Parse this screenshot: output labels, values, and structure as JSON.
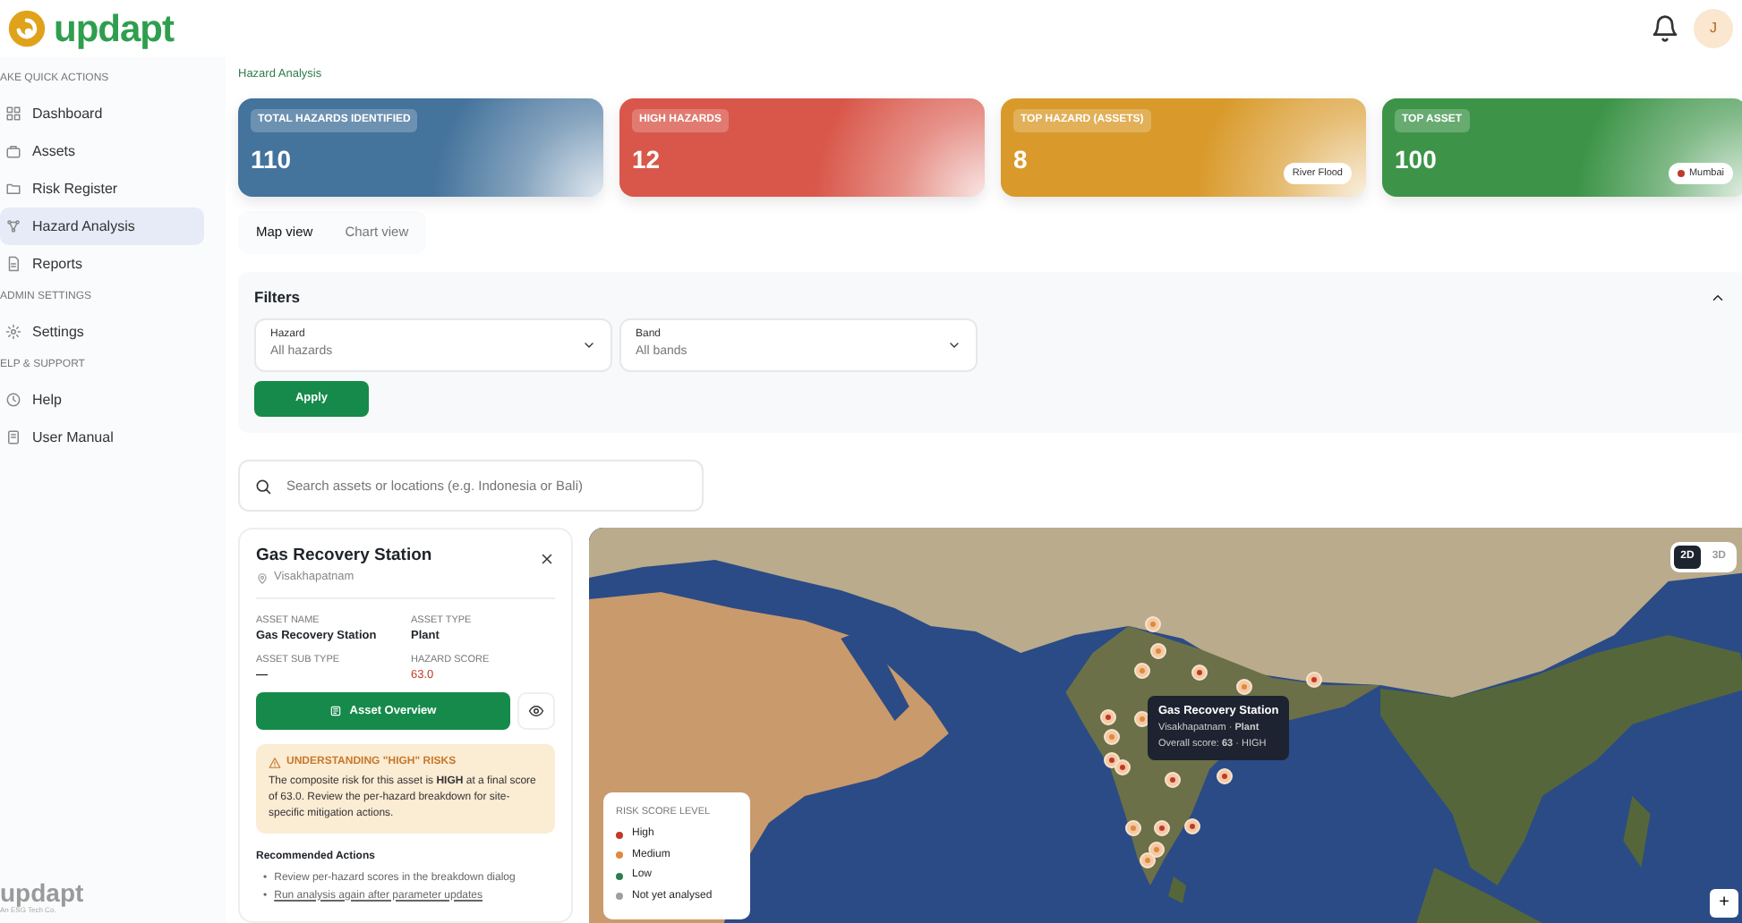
{
  "header": {
    "logo": "updapt",
    "avatar": "J"
  },
  "sidebar": {
    "sections": [
      {
        "heading": "AKE QUICK ACTIONS",
        "items": [
          {
            "label": "Dashboard",
            "selected": false
          },
          {
            "label": "Assets",
            "selected": false
          },
          {
            "label": "Risk Register",
            "selected": false
          },
          {
            "label": "Hazard Analysis",
            "selected": true
          },
          {
            "label": "Reports",
            "selected": false
          }
        ]
      },
      {
        "heading": "ADMIN SETTINGS",
        "items": [
          {
            "label": "Settings",
            "selected": false
          }
        ]
      },
      {
        "heading": "ELP & SUPPORT",
        "items": [
          {
            "label": "Help",
            "selected": false
          },
          {
            "label": "User Manual",
            "selected": false
          }
        ]
      }
    ],
    "footer_logo": "updapt",
    "footer_tagline": "An ESG Tech Co."
  },
  "breadcrumb": "Hazard Analysis",
  "stats": [
    {
      "label": "TOTAL HAZARDS IDENTIFIED",
      "value": "110",
      "color": "#44739c"
    },
    {
      "label": "HIGH HAZARDS",
      "value": "12",
      "color": "#d9574a"
    },
    {
      "label": "TOP HAZARD (ASSETS)",
      "value": "8",
      "color": "#d99a2b",
      "badge": {
        "label": "River Flood"
      }
    },
    {
      "label": "TOP ASSET",
      "value": "100",
      "color": "#3d9448",
      "badge": {
        "label": "Mumbai",
        "color": "#c0392b"
      }
    }
  ],
  "view_tabs": [
    {
      "label": "Map view",
      "selected": true
    },
    {
      "label": "Chart view",
      "selected": false
    }
  ],
  "filters": {
    "title": "Filters",
    "expanded": true,
    "fields": [
      {
        "label": "Hazard",
        "placeholder": "All hazards"
      },
      {
        "label": "Band",
        "placeholder": "All bands"
      }
    ],
    "apply": "Apply"
  },
  "search": {
    "placeholder": "Search assets or locations (e.g. Indonesia or Bali)"
  },
  "asset_panel": {
    "title": "Gas Recovery Station",
    "location": "Visakhapatnam",
    "fields": [
      {
        "label": "ASSET NAME",
        "value": "Gas Recovery Station"
      },
      {
        "label": "ASSET TYPE",
        "value": "Plant"
      },
      {
        "label": "ASSET SUB TYPE",
        "value": "—"
      },
      {
        "label": "HAZARD SCORE",
        "value": "63.0",
        "kind": "score"
      }
    ],
    "overview_button": "Asset Overview",
    "alert": {
      "title": "UNDERSTANDING \"HIGH\" RISKS",
      "text": "The composite risk for this asset is **HIGH** at a final score of 63.0. Review the per-hazard breakdown for site-specific mitigation actions."
    },
    "actions_title": "Recommended Actions",
    "actions": [
      {
        "bullet": "•",
        "text": "Review per-hazard scores in the breakdown dialog"
      },
      {
        "bullet": "•",
        "text": "Run analysis again after parameter updates"
      }
    ]
  },
  "map": {
    "modes": [
      {
        "label": "2D",
        "selected": true
      },
      {
        "label": "3D",
        "selected": false
      }
    ],
    "markers": [
      {
        "color": "#e08a3c"
      },
      {
        "color": "#e08a3c"
      },
      {
        "color": "#e08a3c"
      },
      {
        "color": "#c0392b"
      },
      {
        "color": "#e08a3c"
      },
      {
        "color": "#c0392b"
      },
      {
        "color": "#c0392b"
      },
      {
        "color": "#e08a3c"
      },
      {
        "color": "#e08a3c"
      },
      {
        "color": "#c0392b"
      },
      {
        "color": "#c0392b"
      },
      {
        "color": "#c0392b"
      },
      {
        "color": "#c0392b"
      },
      {
        "color": "#e08a3c"
      },
      {
        "color": "#c0392b"
      },
      {
        "color": "#c0392b"
      },
      {
        "color": "#e08a3c"
      },
      {
        "color": "#e08a3c"
      }
    ],
    "tooltip": {
      "title": "Gas Recovery Station",
      "line1": "Visakhapatnam · **Plant**",
      "line2": "Overall score: **63** · HIGH"
    },
    "legend": {
      "title": "RISK SCORE LEVEL",
      "items": [
        {
          "label": "High",
          "color": "#c0392b"
        },
        {
          "label": "Medium",
          "color": "#e08a3c"
        },
        {
          "label": "Low",
          "color": "#2e7d4f"
        },
        {
          "label": "Not yet analysed",
          "color": "#9e9e9e"
        }
      ]
    },
    "zoom_in": "+"
  }
}
